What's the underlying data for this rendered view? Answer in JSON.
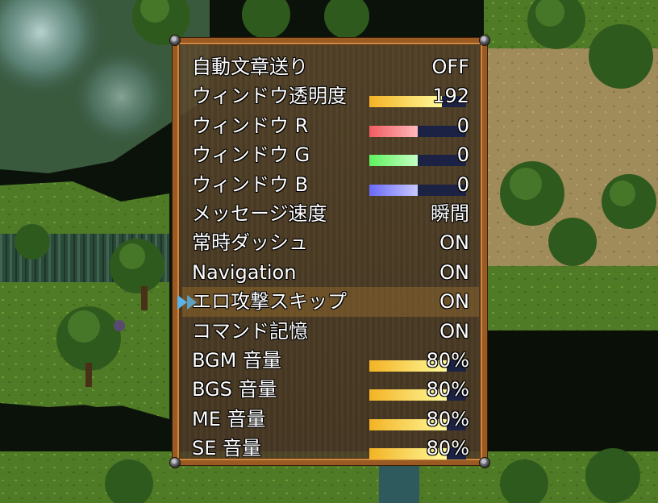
{
  "options": [
    {
      "label": "自動文章送り",
      "value": "OFF"
    },
    {
      "label": "ウィンドウ透明度",
      "value": "192",
      "gauge": 0.75,
      "gauge_color": "yellow"
    },
    {
      "label": "ウィンドウ R",
      "value": "0",
      "gauge": 0.5,
      "gauge_color": "red"
    },
    {
      "label": "ウィンドウ G",
      "value": "0",
      "gauge": 0.5,
      "gauge_color": "green"
    },
    {
      "label": "ウィンドウ B",
      "value": "0",
      "gauge": 0.5,
      "gauge_color": "blue"
    },
    {
      "label": "メッセージ速度",
      "value": "瞬間"
    },
    {
      "label": "常時ダッシュ",
      "value": "ON"
    },
    {
      "label": "Navigation",
      "value": "ON"
    },
    {
      "label": "エロ攻撃スキップ",
      "value": "ON",
      "selected": true
    },
    {
      "label": "コマンド記憶",
      "value": "ON"
    },
    {
      "label": "BGM 音量",
      "value": "80%",
      "gauge": 0.8,
      "gauge_color": "yellow"
    },
    {
      "label": "BGS 音量",
      "value": "80%",
      "gauge": 0.8,
      "gauge_color": "yellow"
    },
    {
      "label": "ME 音量",
      "value": "80%",
      "gauge": 0.8,
      "gauge_color": "yellow"
    },
    {
      "label": "SE 音量",
      "value": "80%",
      "gauge": 0.8,
      "gauge_color": "yellow"
    }
  ],
  "colors": {
    "frame": "#9a5a22",
    "cursor": "#5ab4e8",
    "gauge_back": "#1c2244"
  }
}
